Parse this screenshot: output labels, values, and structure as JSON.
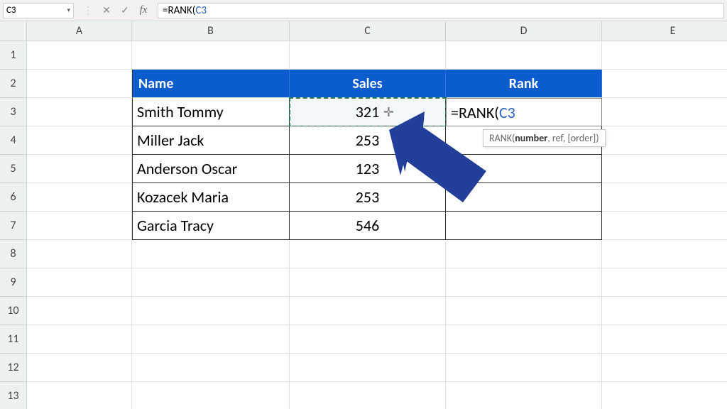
{
  "name_box": "C3",
  "formula_bar": {
    "prefix": "=RANK(",
    "ref": "C3"
  },
  "columns": [
    "A",
    "B",
    "C",
    "D",
    "E"
  ],
  "rows": [
    "1",
    "2",
    "3",
    "4",
    "5",
    "6",
    "7",
    "8",
    "9",
    "10",
    "11",
    "12",
    "13"
  ],
  "table": {
    "headers": {
      "name": "Name",
      "sales": "Sales",
      "rank": "Rank"
    },
    "rows": [
      {
        "name": "Smith Tommy",
        "sales": "321"
      },
      {
        "name": "Miller Jack",
        "sales": "253"
      },
      {
        "name": "Anderson Oscar",
        "sales": "123"
      },
      {
        "name": "Kozacek Maria",
        "sales": "253"
      },
      {
        "name": "Garcia Tracy",
        "sales": "546"
      }
    ]
  },
  "editing_cell": {
    "prefix": "=RANK(",
    "ref": "C3"
  },
  "tooltip": {
    "fn": "RANK(",
    "hl": "number",
    "rest": ", ref, [order])"
  }
}
